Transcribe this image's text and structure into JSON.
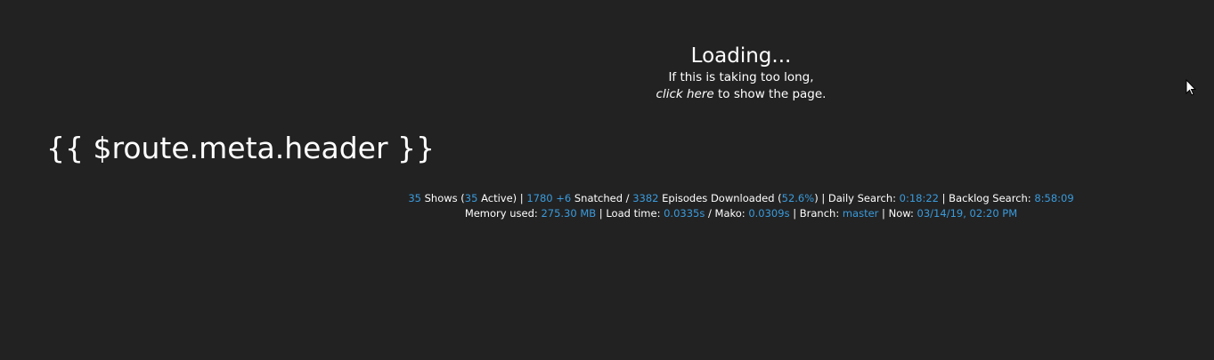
{
  "loading": {
    "title": "Loading...",
    "line1": "If this is taking too long,",
    "link": "click here",
    "line2_rest": " to show the page."
  },
  "header": {
    "title": "{{ $route.meta.header }}"
  },
  "footer": {
    "line1": {
      "shows_count": "35",
      "shows_label": " Shows (",
      "active_count": "35",
      "active_label": " Active) | ",
      "snatched_count": "1780",
      "snatched_delta": "+6",
      "snatched_label": " Snatched  / ",
      "episodes_count": "3382",
      "episodes_label": " Episodes Downloaded (",
      "episodes_percent": "52.6%",
      "daily_label": ") | Daily Search: ",
      "daily_value": "0:18:22",
      "backlog_label": " | Backlog Search: ",
      "backlog_value": "8:58:09"
    },
    "line2": {
      "memory_label": "Memory used: ",
      "memory_value": "275.30 MB",
      "load_label": " | Load time: ",
      "load_value": "0.0335s",
      "mako_label": " / Mako: ",
      "mako_value": "0.0309s",
      "branch_label": " | Branch: ",
      "branch_value": "master",
      "now_label": " | Now: ",
      "now_value": "03/14/19, 02:20 PM"
    }
  },
  "colors": {
    "background": "#222222",
    "text": "#ffffff",
    "accent": "#3a9bdc"
  },
  "icons": {
    "cursor": "mouse-pointer-icon"
  }
}
